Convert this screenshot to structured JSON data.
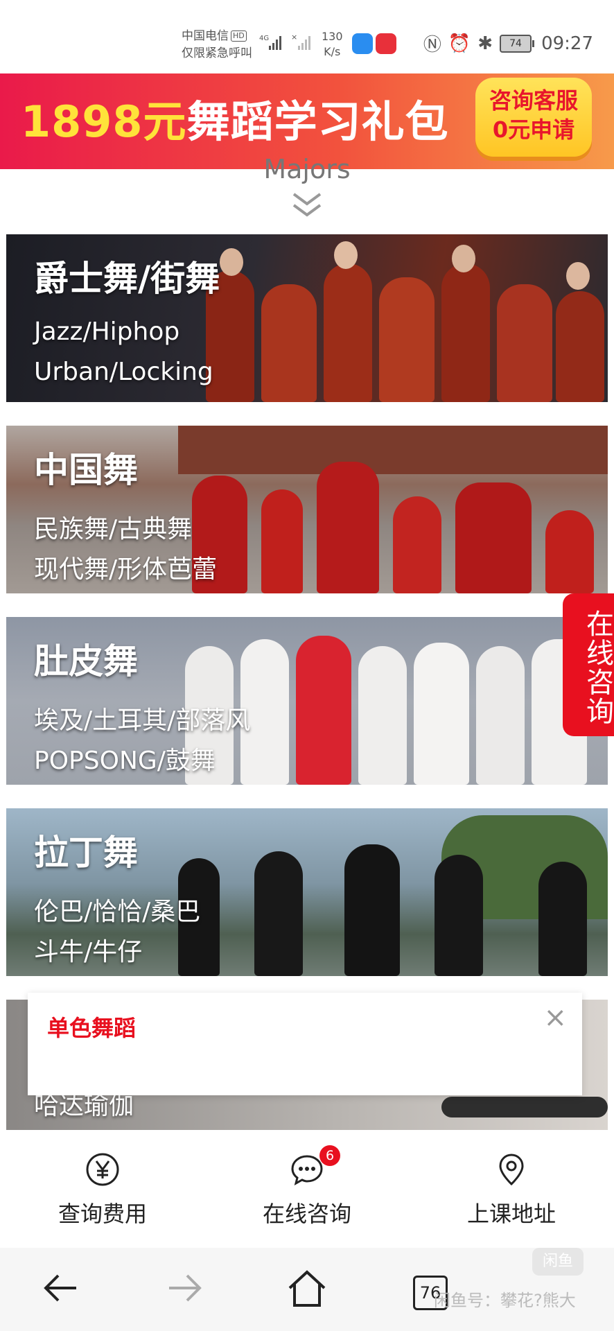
{
  "status_bar": {
    "carrier": "中国电信",
    "hd_badge": "HD",
    "emergency": "仅限紧急呼叫",
    "network": "4G",
    "speed_value": "130",
    "speed_unit": "K/s",
    "battery": "74",
    "time": "09:27"
  },
  "banner": {
    "price_text": "1898元",
    "title_text": "舞蹈学习礼包",
    "consult_line1": "咨询客服",
    "consult_line2": "0元申请"
  },
  "majors_label": "Majors",
  "categories": [
    {
      "title": "爵士舞/街舞",
      "line1": "Jazz/Hiphop",
      "line2": "Urban/Locking"
    },
    {
      "title": "中国舞",
      "line1": "民族舞/古典舞",
      "line2": "现代舞/形体芭蕾"
    },
    {
      "title": "肚皮舞",
      "line1": "埃及/土耳其/部落风",
      "line2": "POPSONG/鼓舞"
    },
    {
      "title": "拉丁舞",
      "line1": "伦巴/恰恰/桑巴",
      "line2": "斗牛/牛仔"
    },
    {
      "title": "",
      "line1": "哈达瑜伽",
      "line2": ""
    }
  ],
  "side_consult": "在线咨询",
  "popup": {
    "title": "单色舞蹈",
    "close": "×"
  },
  "bottom_nav": [
    {
      "label": "查询费用",
      "icon": "yen-icon"
    },
    {
      "label": "在线咨询",
      "icon": "chat-icon",
      "badge": "6"
    },
    {
      "label": "上课地址",
      "icon": "location-icon"
    }
  ],
  "system_nav": {
    "tab_count": "76"
  },
  "watermark": "闲鱼号：攀花?熊大",
  "watermark_logo": "闲鱼",
  "colors": {
    "brand_red": "#e8101f",
    "banner_yellow": "#ffe33a"
  }
}
